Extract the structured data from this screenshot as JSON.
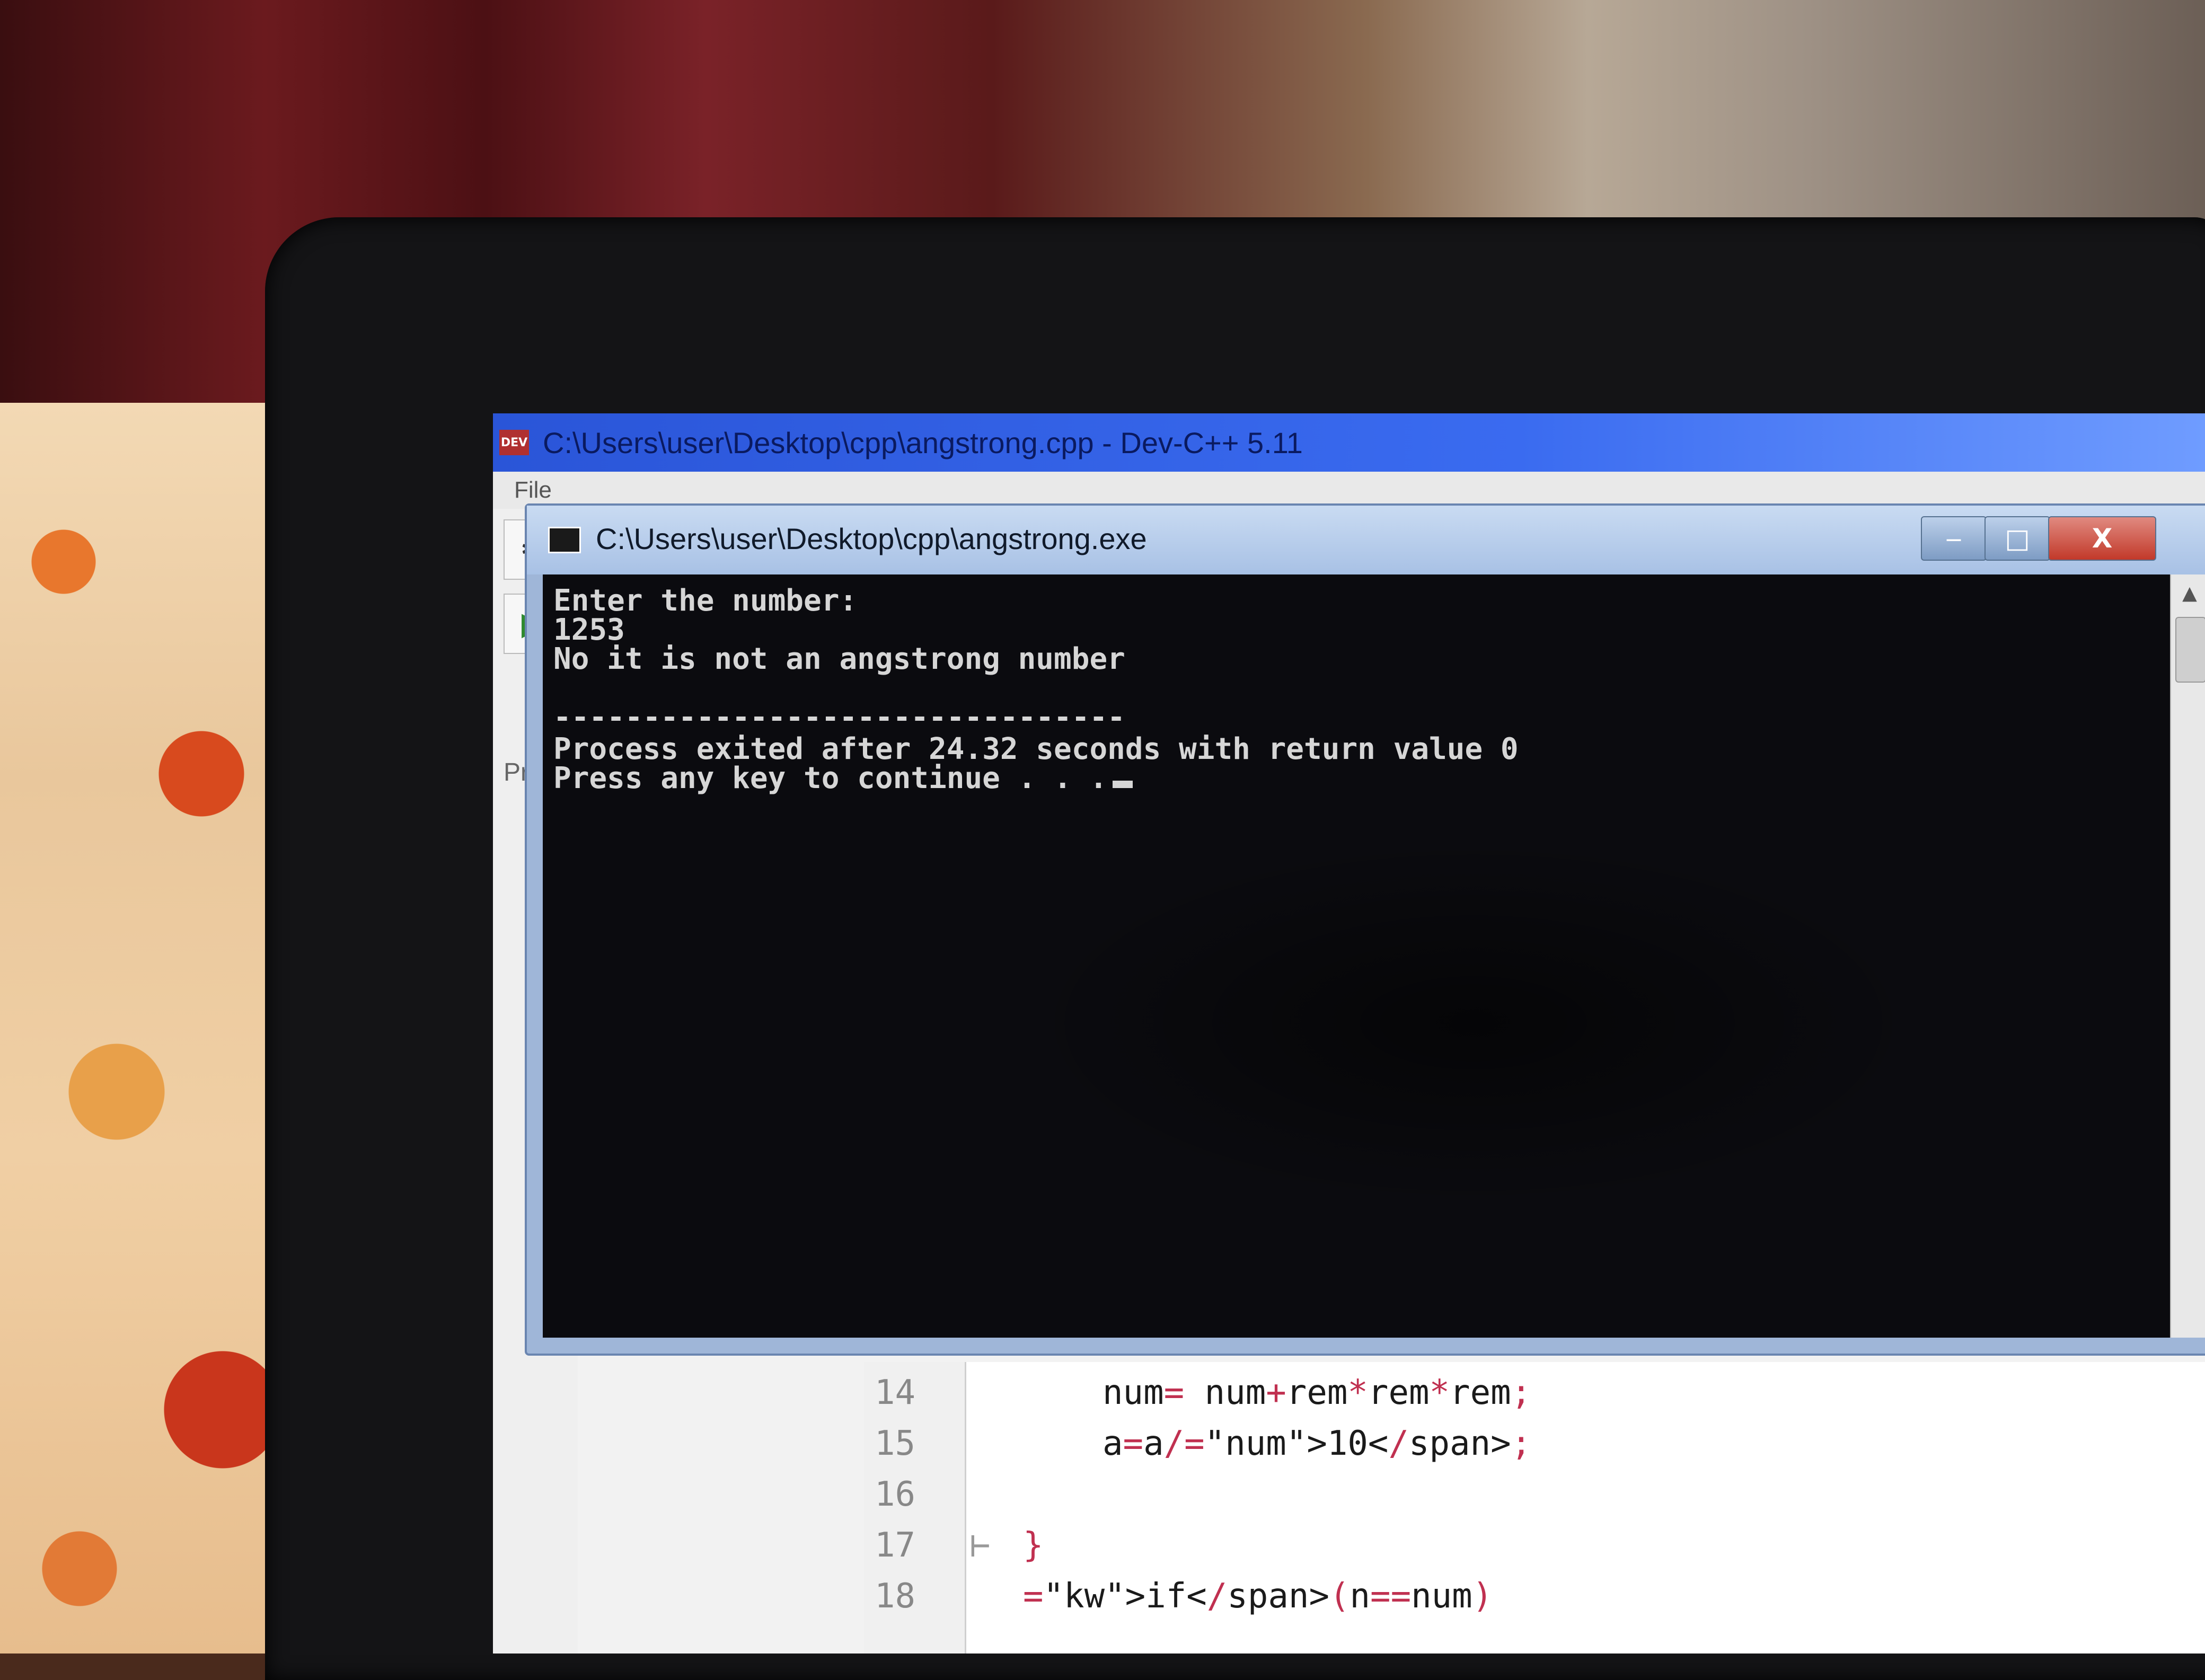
{
  "devcpp": {
    "app_icon": "DEV",
    "title": "C:\\Users\\user\\Desktop\\cpp\\angstrong.cpp - Dev-C++ 5.11",
    "menu_file": "File",
    "project_tab": "Pro",
    "toolbar_icons": [
      "compile-icon",
      "run-icon"
    ]
  },
  "console": {
    "title": "C:\\Users\\user\\Desktop\\cpp\\angstrong.exe",
    "buttons": {
      "minimize": "‒",
      "maximize": "□",
      "close": "X"
    },
    "lines": [
      "Enter the number:",
      "1253",
      "No it is not an angstrong number",
      "",
      "--------------------------------",
      "Process exited after 24.32 seconds with return value 0",
      "Press any key to continue . . ."
    ]
  },
  "editor": {
    "lines": [
      {
        "num": "14",
        "code": "num= num+rem*rem*rem;"
      },
      {
        "num": "15",
        "code": "a=a/10;"
      },
      {
        "num": "16",
        "code": ""
      },
      {
        "num": "17",
        "code": "}"
      },
      {
        "num": "18",
        "code": "if(n==num)"
      }
    ]
  },
  "colors": {
    "console_bg": "#0b0b0f",
    "console_text": "#d6d6d6",
    "devcpp_title": "#2a55d8"
  }
}
